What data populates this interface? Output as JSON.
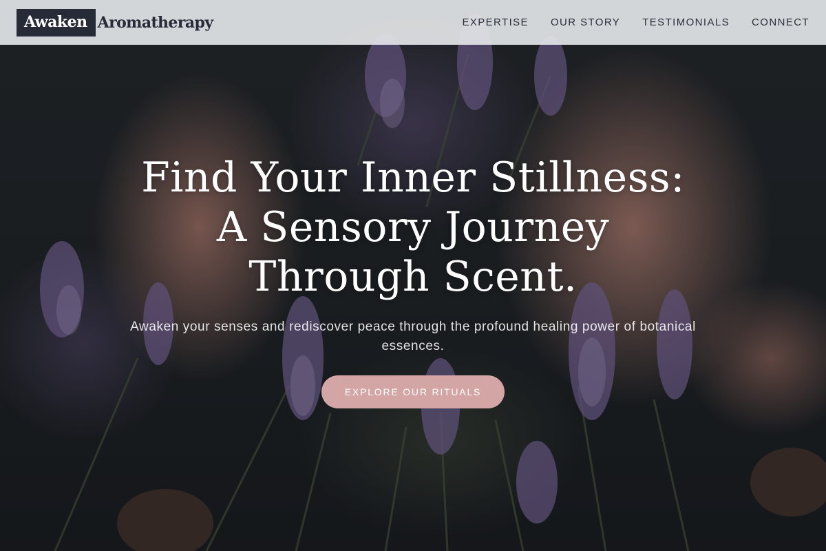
{
  "brand": {
    "name_part1": "Awaken",
    "name_part2": "Aromatherapy",
    "logo_box_color": "#272b38"
  },
  "nav": {
    "items": [
      {
        "label": "EXPERTISE"
      },
      {
        "label": "OUR STORY"
      },
      {
        "label": "TESTIMONIALS"
      },
      {
        "label": "CONNECT"
      }
    ]
  },
  "hero": {
    "title_lines": [
      "Find Your Inner Stillness:",
      "A Sensory Journey",
      "Through Scent."
    ],
    "subtitle": "Awaken your senses and rediscover peace through the profound healing power of botanical essences.",
    "cta_label": "EXPLORE OUR RITUALS",
    "cta_color": "#d4a5a5",
    "background_image": "hands-holding-lavender-photo"
  }
}
